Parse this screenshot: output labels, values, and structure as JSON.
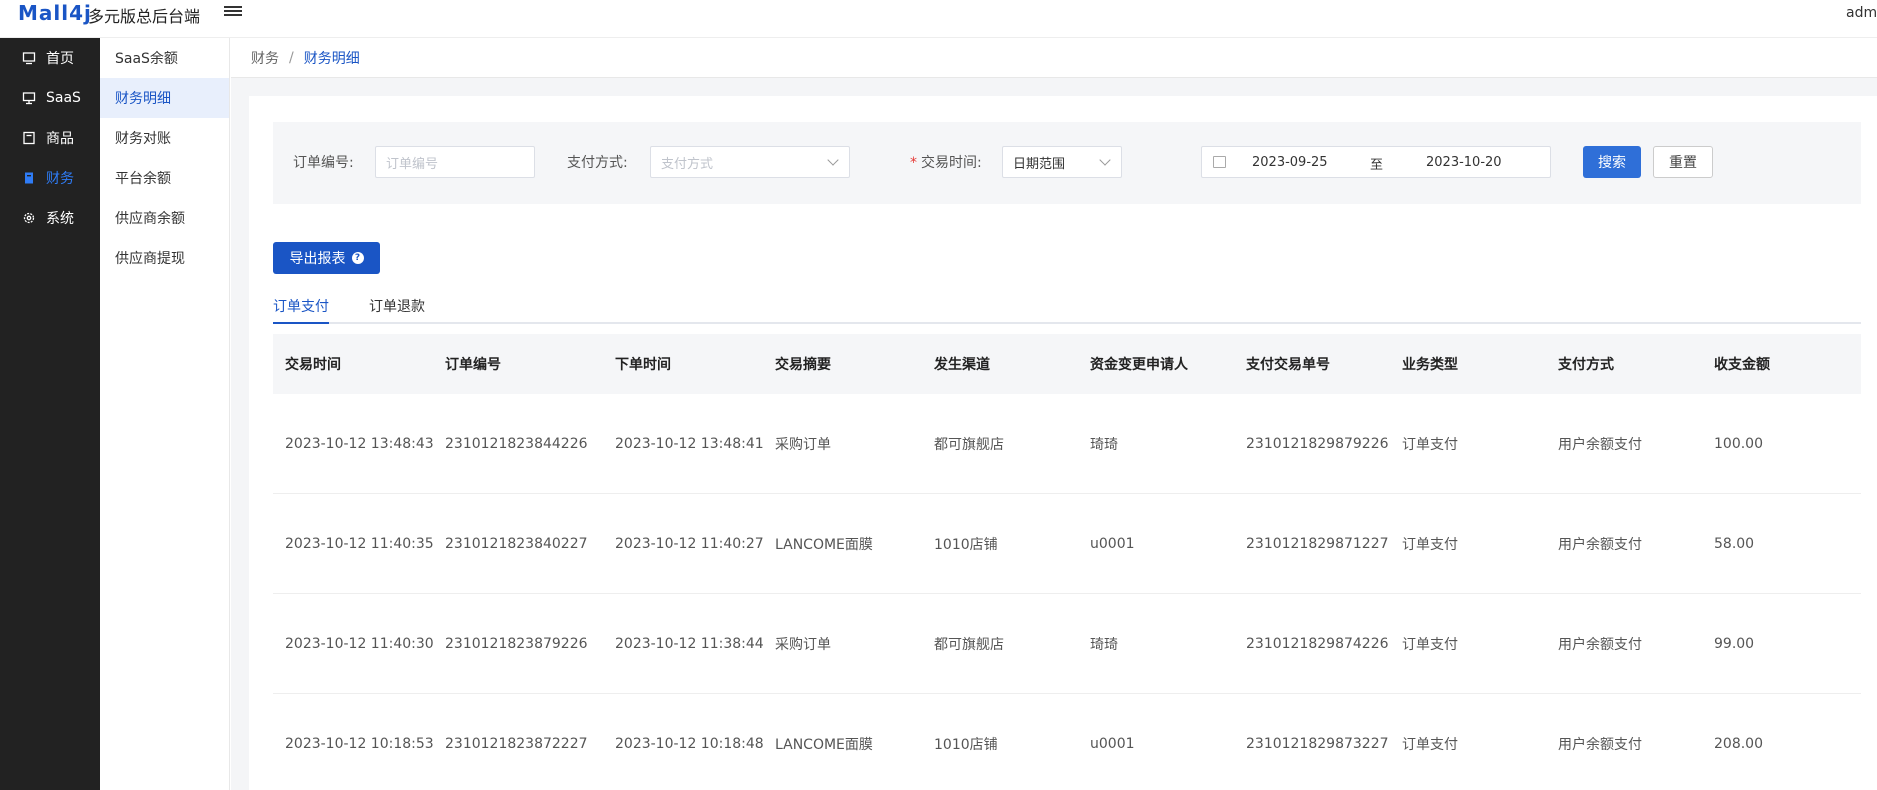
{
  "header": {
    "logo": "Mall4j",
    "title": "多元版总后台端",
    "user": "admin"
  },
  "sidebar": {
    "items": [
      {
        "label": "首页",
        "icon": "home-icon"
      },
      {
        "label": "SaaS",
        "icon": "monitor-icon"
      },
      {
        "label": "商品",
        "icon": "product-icon"
      },
      {
        "label": "财务",
        "icon": "finance-icon",
        "active": true
      },
      {
        "label": "系统",
        "icon": "gear-icon"
      }
    ]
  },
  "submenu": {
    "items": [
      {
        "label": "SaaS余额"
      },
      {
        "label": "财务明细",
        "active": true
      },
      {
        "label": "财务对账"
      },
      {
        "label": "平台余额"
      },
      {
        "label": "供应商余额"
      },
      {
        "label": "供应商提现"
      }
    ]
  },
  "breadcrumb": {
    "parent": "财务",
    "separator": "/",
    "current": "财务明细"
  },
  "search": {
    "order_label": "订单编号:",
    "order_placeholder": "订单编号",
    "pay_label": "支付方式:",
    "pay_placeholder": "支付方式",
    "time_required": "*",
    "time_label": "交易时间:",
    "time_type": "日期范围",
    "date_start": "2023-09-25",
    "date_to": "至",
    "date_end": "2023-10-20",
    "search_btn": "搜索",
    "reset_btn": "重置"
  },
  "export_btn": "导出报表",
  "tabs": [
    {
      "label": "订单支付",
      "active": true
    },
    {
      "label": "订单退款"
    }
  ],
  "table": {
    "headers": [
      "交易时间",
      "订单编号",
      "下单时间",
      "交易摘要",
      "发生渠道",
      "资金变更申请人",
      "支付交易单号",
      "业务类型",
      "支付方式",
      "收支金额"
    ],
    "rows": [
      [
        "2023-10-12 13:48:43",
        "2310121823844226",
        "2023-10-12 13:48:41",
        "采购订单",
        "都可旗舰店",
        "琦琦",
        "2310121829879226",
        "订单支付",
        "用户余额支付",
        "100.00"
      ],
      [
        "2023-10-12 11:40:35",
        "2310121823840227",
        "2023-10-12 11:40:27",
        "LANCOME面膜",
        "1010店铺",
        "u0001",
        "2310121829871227",
        "订单支付",
        "用户余额支付",
        "58.00"
      ],
      [
        "2023-10-12 11:40:30",
        "2310121823879226",
        "2023-10-12 11:38:44",
        "采购订单",
        "都可旗舰店",
        "琦琦",
        "2310121829874226",
        "订单支付",
        "用户余额支付",
        "99.00"
      ],
      [
        "2023-10-12 10:18:53",
        "2310121823872227",
        "2023-10-12 10:18:48",
        "LANCOME面膜",
        "1010店铺",
        "u0001",
        "2310121829873227",
        "订单支付",
        "用户余额支付",
        "208.00"
      ]
    ]
  },
  "colors": {
    "primary": "#1a55c5",
    "sidebar_bg": "#222222",
    "active_text": "#2f7cf6"
  }
}
